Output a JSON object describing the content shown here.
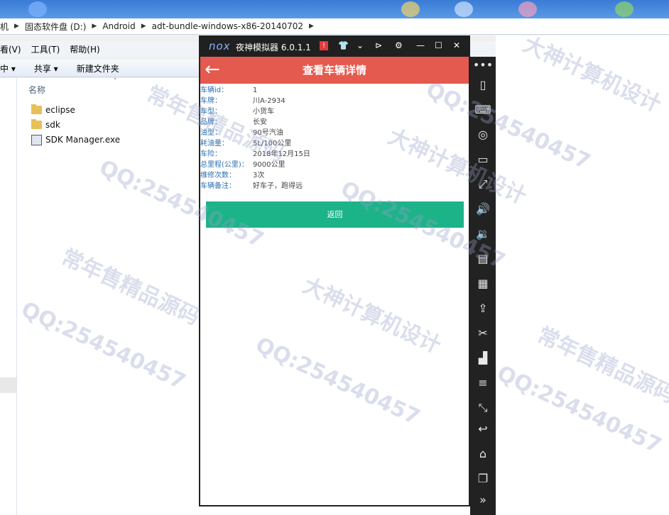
{
  "explorer": {
    "breadcrumb": [
      "机",
      "固态软件盘 (D:)",
      "Android",
      "adt-bundle-windows-x86-20140702"
    ],
    "menu": [
      "看(V)",
      "工具(T)",
      "帮助(H)"
    ],
    "toolbar": [
      "中 ▾",
      "共享 ▾",
      "新建文件夹"
    ],
    "column_header": "名称",
    "files": [
      {
        "name": "eclipse",
        "icon": "folder-icon"
      },
      {
        "name": "sdk",
        "icon": "folder-icon"
      },
      {
        "name": "SDK Manager.exe",
        "icon": "exe-icon"
      }
    ]
  },
  "emulator": {
    "logo": "nox",
    "title": "夜神模拟器 6.0.1.1",
    "warning": "!",
    "app": {
      "title": "查看车辆详情",
      "fields": [
        {
          "label": "车辆id：",
          "value": "1"
        },
        {
          "label": "车牌：",
          "value": "川A-2934"
        },
        {
          "label": "车型：",
          "value": "小货车"
        },
        {
          "label": "品牌：",
          "value": "长安"
        },
        {
          "label": "油型：",
          "value": "90号汽油"
        },
        {
          "label": "耗油量：",
          "value": "5L/100公里"
        },
        {
          "label": "车险：",
          "value": "2018年12月15日"
        },
        {
          "label": "总里程(公里)：",
          "value": "9000公里"
        },
        {
          "label": "维修次数：",
          "value": "3次"
        },
        {
          "label": "车辆备注：",
          "value": "好车子，跑得远"
        }
      ],
      "button": "返回"
    }
  },
  "watermarks": [
    "QQ:254540457",
    "常年售精品源码",
    "大神计算机设计"
  ],
  "colors": {
    "appbar": "#e55a4e",
    "button": "#1db388",
    "label": "#2b6fb3"
  }
}
